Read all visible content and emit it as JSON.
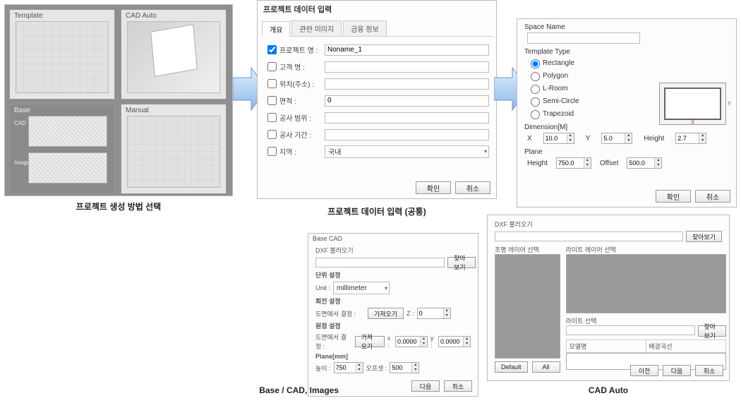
{
  "thumbs": {
    "template": "Template",
    "cad_auto": "CAD Auto",
    "base": "Base",
    "manual": "Manual",
    "cad_tag": "CAD",
    "image_tag": "Image"
  },
  "captions": {
    "c1": "프로젝트 생성 방법 선택",
    "c2": "프로젝트 데이터 입력 (공통)",
    "c3": "Base / CAD, Images",
    "c4": "CAD Auto"
  },
  "data_entry": {
    "title": "프로젝트 데이터 입력",
    "tabs": {
      "t1": "개요",
      "t2": "관련 이미지",
      "t3": "금융 정보"
    },
    "rows": {
      "project_name_lbl": "프로젝트 명 :",
      "project_name_val": "Noname_1",
      "client_lbl": "고객 명 :",
      "client_val": "",
      "addr_lbl": "위치(주소) :",
      "addr_val": "",
      "area_lbl": "면적 :",
      "area_val": "0",
      "scope_lbl": "공사 범위 :",
      "scope_val": "",
      "period_lbl": "공사 기간 :",
      "period_val": "",
      "region_lbl": "지역 :",
      "region_val": "국내"
    },
    "ok": "확인",
    "cancel": "취소"
  },
  "space": {
    "space_name_lbl": "Space Name",
    "space_name_val": "",
    "template_type_lbl": "Template Type",
    "types": {
      "rect": "Rectangle",
      "poly": "Polygon",
      "lroom": "L-Room",
      "semi": "Semi-Circle",
      "trap": "Trapezoid"
    },
    "dim_lbl": "Dimension[M]",
    "x_lbl": "X",
    "x_val": "10.0",
    "y_lbl": "Y",
    "y_val": "5.0",
    "h_lbl": "Height",
    "h_val": "2.7",
    "plane_lbl": "Plane",
    "plane_h_lbl": "Height",
    "plane_h_val": "750.0",
    "plane_off_lbl": "Offset",
    "plane_off_val": "500.0",
    "ok": "확인",
    "cancel": "취소",
    "preview_x": "X",
    "preview_y": "Y"
  },
  "base_cad": {
    "title": "Base CAD",
    "dxf_lbl": "DXF 불러오기",
    "browse": "찾아보기",
    "unit_group": "단위 설정",
    "unit_lbl": "Unit :",
    "unit_val": "millimeter",
    "rot_group": "회전 설정",
    "rot_lbl": "도면에서 결정 :",
    "pick": "가져오기",
    "z_lbl": "Z :",
    "z_val": "0",
    "orig_group": "원점 설정",
    "orig_lbl": "도면에서 결정 :",
    "ox_lbl": "x :",
    "ox_val": "0.0000",
    "oy_lbl": "y :",
    "oy_val": "0.0000",
    "plane_group": "Plane[mm]",
    "ph_lbl": "높이 :",
    "ph_val": "750",
    "po_lbl": "오프셋 :",
    "po_val": "500",
    "next": "다음",
    "cancel": "취소"
  },
  "cad_auto": {
    "dxf_lbl": "DXF 불러오기",
    "browse": "찾아보기",
    "zone_lbl": "조명 레이어 선택",
    "light_lbl": "라이트 레이어 선택",
    "light_sel_lbl": "라이트 선택",
    "browse2": "찾아보기",
    "col_model": "모델명",
    "col_spec": "배광곡선",
    "default": "Default",
    "all": "All",
    "prev": "이전",
    "next": "다음",
    "cancel": "취소"
  }
}
